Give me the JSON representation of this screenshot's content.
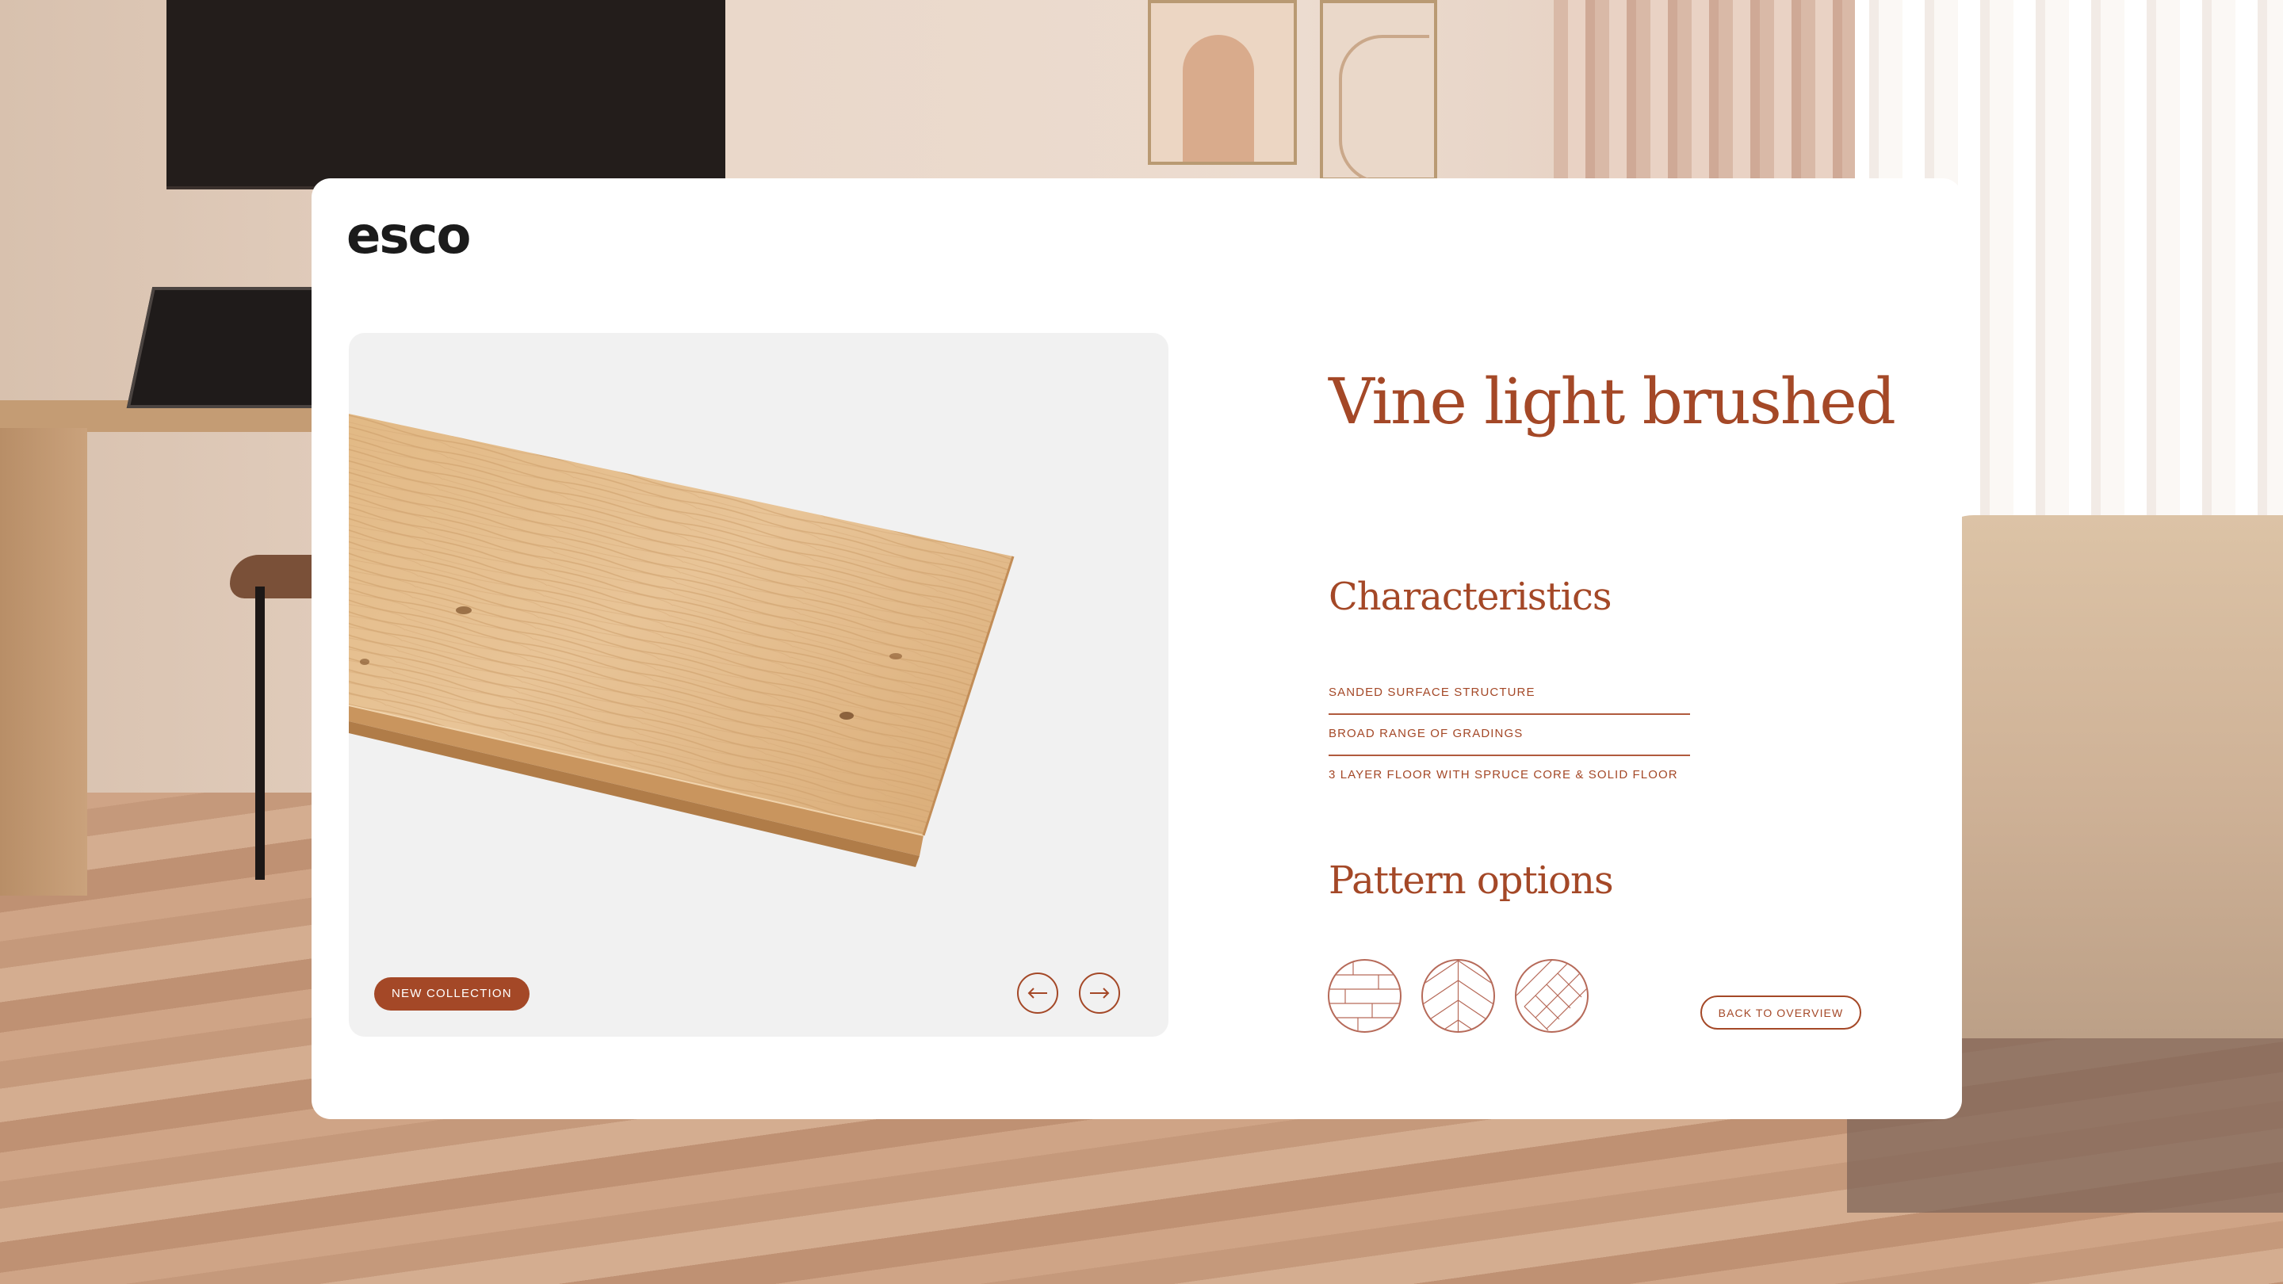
{
  "brand": {
    "logo_text": "esco",
    "accent_color": "#a44827"
  },
  "product": {
    "title": "Vine light brushed",
    "badge": "NEW COLLECTION"
  },
  "gallery": {
    "prev_icon": "arrow-left-icon",
    "next_icon": "arrow-right-icon"
  },
  "characteristics": {
    "heading": "Characteristics",
    "items": [
      "SANDED SURFACE STRUCTURE",
      "BROAD RANGE OF GRADINGS",
      "3 LAYER FLOOR WITH SPRUCE CORE & SOLID FLOOR"
    ]
  },
  "patterns": {
    "heading": "Pattern options",
    "options": [
      "plank-pattern-icon",
      "chevron-pattern-icon",
      "herringbone-pattern-icon"
    ]
  },
  "actions": {
    "back_label": "BACK TO OVERVIEW"
  }
}
